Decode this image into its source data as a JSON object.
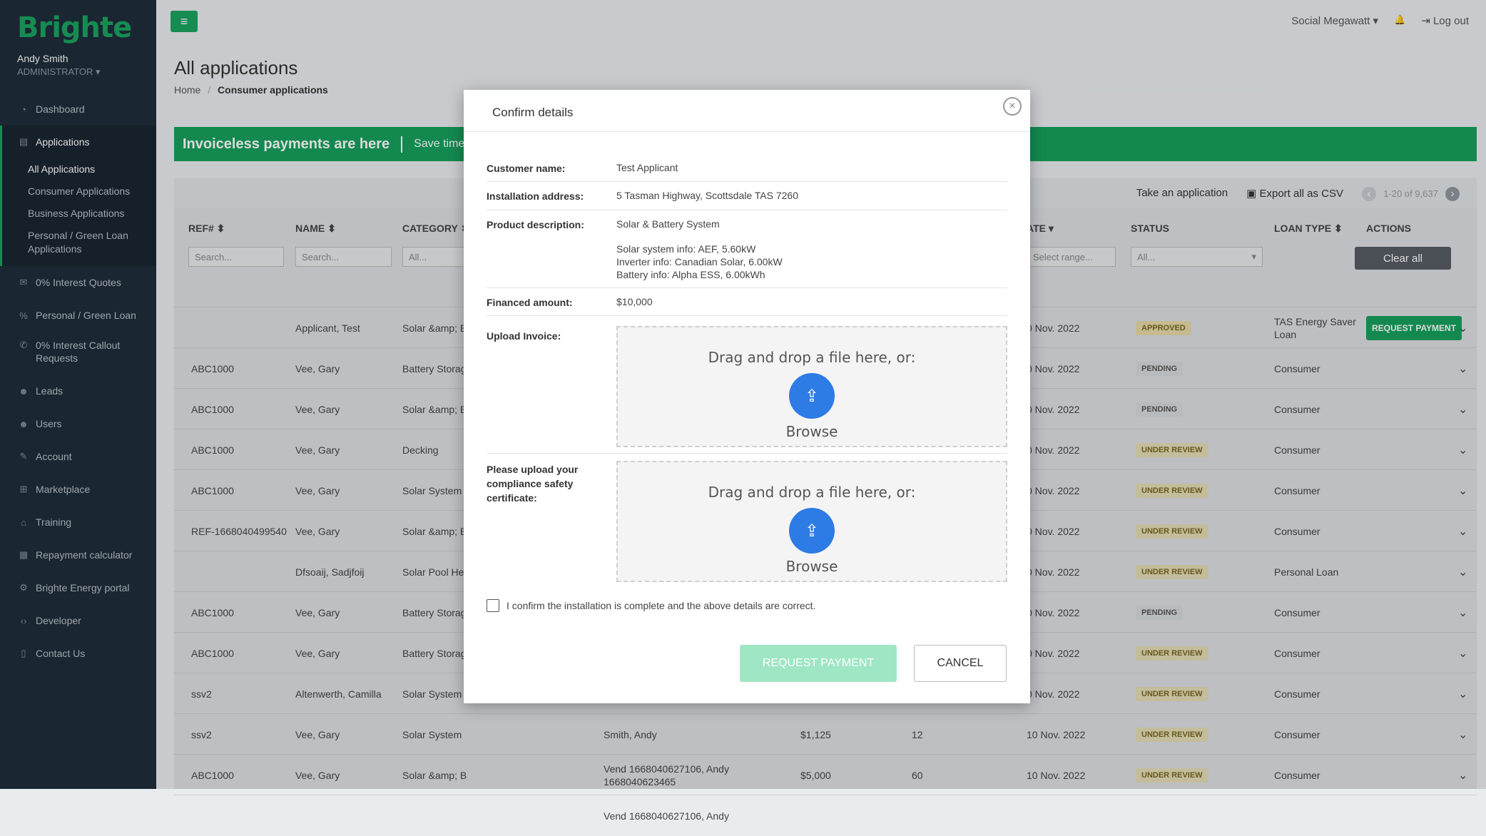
{
  "sidebar": {
    "logo": "Brighte",
    "user": {
      "name": "Andy Smith",
      "role": "ADMINISTRATOR ▾"
    },
    "items": [
      {
        "label": "Dashboard",
        "icon": "dashboard-icon",
        "glyph": "◔"
      },
      {
        "label": "Applications",
        "icon": "file-icon",
        "glyph": "▤"
      },
      {
        "label": "0% Interest Quotes",
        "icon": "envelope-icon",
        "glyph": "✉"
      },
      {
        "label": "Personal / Green Loan",
        "icon": "percent-icon",
        "glyph": "%"
      },
      {
        "label": "0% Interest Callout Requests",
        "icon": "phone-icon",
        "glyph": "✆"
      },
      {
        "label": "Leads",
        "icon": "users-icon",
        "glyph": "☻"
      },
      {
        "label": "Users",
        "icon": "users-icon",
        "glyph": "☻"
      },
      {
        "label": "Account",
        "icon": "wrench-icon",
        "glyph": "✎"
      },
      {
        "label": "Marketplace",
        "icon": "cart-icon",
        "glyph": "⊞"
      },
      {
        "label": "Training",
        "icon": "graduation-icon",
        "glyph": "⌂"
      },
      {
        "label": "Repayment calculator",
        "icon": "calculator-icon",
        "glyph": "▦"
      },
      {
        "label": "Brighte Energy portal",
        "icon": "energy-icon",
        "glyph": "⚙"
      },
      {
        "label": "Developer",
        "icon": "code-icon",
        "glyph": "‹›"
      },
      {
        "label": "Contact Us",
        "icon": "contact-icon",
        "glyph": "▯"
      }
    ],
    "sub_items": [
      "All Applications",
      "Consumer Applications",
      "Business Applications",
      "Personal / Green Loan Applications"
    ]
  },
  "header": {
    "menu_glyph": "≡",
    "org": "Social Megawatt ▾",
    "bell": "🔔",
    "logout": "⇥ Log out"
  },
  "page": {
    "title": "All applications",
    "breadcrumb_home": "Home",
    "breadcrumb_sep": "/",
    "breadcrumb_current": "Consumer applications"
  },
  "banner": {
    "title": "Invoiceless payments are here",
    "text": "Save time an"
  },
  "toolbar": {
    "take": "Take an application",
    "export": "▣ Export all as CSV",
    "prev": "‹",
    "pagination": "1-20 of 9,637",
    "next": "›"
  },
  "table": {
    "headers": {
      "ref": "REF# ⬍",
      "name": "NAME ⬍",
      "category": "CATEGORY ⬍",
      "date": "ATE ▾",
      "status": "STATUS",
      "loan": "LOAN TYPE ⬍",
      "actions": "ACTIONS"
    },
    "filters": {
      "ref": "Search...",
      "name": "Search...",
      "category": "All...",
      "date": "Select range...",
      "status": "All...",
      "status_caret": "▾",
      "clear": "Clear all"
    },
    "rows": [
      {
        "ref": "",
        "name": "Applicant, Test",
        "category": "Solar &amp; B",
        "client": "",
        "amount": "",
        "term": "",
        "date": "0 Nov. 2022",
        "status": "APPROVED",
        "loan": "TAS Energy Saver Loan",
        "action": "REQUEST PAYMENT",
        "chev": "⌄"
      },
      {
        "ref": "ABC1000",
        "name": "Vee, Gary",
        "category": "Battery Storag",
        "client": "",
        "amount": "",
        "term": "",
        "date": "0 Nov. 2022",
        "status": "PENDING",
        "loan": "Consumer",
        "action": "",
        "chev": "⌄"
      },
      {
        "ref": "ABC1000",
        "name": "Vee, Gary",
        "category": "Solar &amp; B",
        "client": "",
        "amount": "",
        "term": "",
        "date": "0 Nov. 2022",
        "status": "PENDING",
        "loan": "Consumer",
        "action": "",
        "chev": "⌄"
      },
      {
        "ref": "ABC1000",
        "name": "Vee, Gary",
        "category": "Decking",
        "client": "",
        "amount": "",
        "term": "",
        "date": "0 Nov. 2022",
        "status": "UNDER REVIEW",
        "loan": "Consumer",
        "action": "",
        "chev": "⌄"
      },
      {
        "ref": "ABC1000",
        "name": "Vee, Gary",
        "category": "Solar System",
        "client": "",
        "amount": "",
        "term": "",
        "date": "0 Nov. 2022",
        "status": "UNDER REVIEW",
        "loan": "Consumer",
        "action": "",
        "chev": "⌄"
      },
      {
        "ref": "REF-1668040499540",
        "name": "Vee, Gary",
        "category": "Solar &amp; B",
        "client": "",
        "amount": "",
        "term": "",
        "date": "0 Nov. 2022",
        "status": "UNDER REVIEW",
        "loan": "Consumer",
        "action": "",
        "chev": "⌄"
      },
      {
        "ref": "",
        "name": "Dfsoaij, Sadjfoij",
        "category": "Solar Pool Hea",
        "client": "",
        "amount": "",
        "term": "",
        "date": "0 Nov. 2022",
        "status": "UNDER REVIEW",
        "loan": "Personal Loan",
        "action": "",
        "chev": "⌄"
      },
      {
        "ref": "ABC1000",
        "name": "Vee, Gary",
        "category": "Battery Storag",
        "client": "",
        "amount": "",
        "term": "",
        "date": "0 Nov. 2022",
        "status": "PENDING",
        "loan": "Consumer",
        "action": "",
        "chev": "⌄"
      },
      {
        "ref": "ABC1000",
        "name": "Vee, Gary",
        "category": "Battery Storag",
        "client": "",
        "amount": "",
        "term": "",
        "date": "0 Nov. 2022",
        "status": "UNDER REVIEW",
        "loan": "Consumer",
        "action": "",
        "chev": "⌄"
      },
      {
        "ref": "ssv2",
        "name": "Altenwerth, Camilla",
        "category": "Solar System",
        "client": "",
        "amount": "",
        "term": "",
        "date": "0 Nov. 2022",
        "status": "UNDER REVIEW",
        "loan": "Consumer",
        "action": "",
        "chev": "⌄"
      },
      {
        "ref": "ssv2",
        "name": "Vee, Gary",
        "category": "Solar System",
        "client": "Smith, Andy",
        "amount": "$1,125",
        "term": "12",
        "date": "10 Nov. 2022",
        "status": "UNDER REVIEW",
        "loan": "Consumer",
        "action": "",
        "chev": "⌄"
      },
      {
        "ref": "ABC1000",
        "name": "Vee, Gary",
        "category": "Solar &amp; Battery System",
        "client": "Vend 1668040627106, Andy 1668040623465",
        "amount": "$5,000",
        "term": "60",
        "date": "10 Nov. 2022",
        "status": "UNDER REVIEW",
        "loan": "Consumer",
        "action": "",
        "chev": "⌄"
      },
      {
        "ref": "",
        "name": "",
        "category": "",
        "client": "Vend 1668040627106, Andy",
        "amount": "",
        "term": "",
        "date": "",
        "status": "",
        "loan": "",
        "action": "",
        "chev": ""
      }
    ]
  },
  "modal": {
    "title": "Confirm details",
    "close_glyph": "×",
    "customer_label": "Customer name:",
    "customer_value": "Test Applicant",
    "address_label": "Installation address:",
    "address_value": "5 Tasman Highway, Scottsdale TAS 7260",
    "product_label": "Product description:",
    "product_value": "Solar & Battery System",
    "solar_info": "Solar system info: AEF, 5.60kW",
    "inverter_info": "Inverter info: Canadian Solar, 6.00kW",
    "battery_info": "Battery info: Alpha ESS, 6.00kWh",
    "financed_label": "Financed amount:",
    "financed_value": "$10,000",
    "invoice_label": "Upload Invoice:",
    "compliance_label": "Please upload your compliance safety certificate:",
    "dropzone_text": "Drag and drop a file here, or:",
    "browse": "Browse",
    "upload_glyph": "⇪",
    "confirm_text": "I confirm the installation is complete and the above details are correct.",
    "request_button": "REQUEST PAYMENT",
    "cancel_button": "CANCEL"
  },
  "colors": {
    "brand": "#1aa260",
    "sidebar": "#1f2d3a",
    "disabled_button": "#9fe6c4",
    "upload_button": "#2d7be5"
  }
}
